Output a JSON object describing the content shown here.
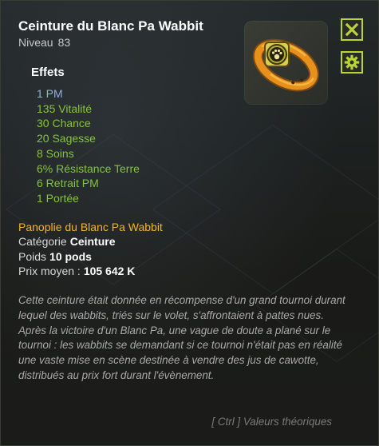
{
  "item": {
    "name": "Ceinture du Blanc Pa Wabbit",
    "level_label": "Niveau",
    "level_value": "83",
    "icon": "belt-item-icon"
  },
  "buttons": {
    "close_icon": "close-icon",
    "settings_icon": "gear-icon"
  },
  "effects": {
    "header": "Effets",
    "items": [
      {
        "text": "1 PM",
        "color": "#8fb0e0"
      },
      {
        "text": "135 Vitalité",
        "color": "#86c33a"
      },
      {
        "text": "30 Chance",
        "color": "#86c33a"
      },
      {
        "text": "20 Sagesse",
        "color": "#86c33a"
      },
      {
        "text": "8 Soins",
        "color": "#86c33a"
      },
      {
        "text": "6% Résistance Terre",
        "color": "#86c33a"
      },
      {
        "text": "6 Retrait PM",
        "color": "#86c33a"
      },
      {
        "text": "1 Portée",
        "color": "#86c33a"
      }
    ]
  },
  "details": {
    "set_name": "Panoplie du Blanc Pa Wabbit",
    "category_label": "Catégorie",
    "category_value": "Ceinture",
    "weight_label": "Poids",
    "weight_value": "10 pods",
    "price_label": "Prix moyen :",
    "price_value": "105 642 K"
  },
  "description": "Cette ceinture était donnée en récompense d'un grand tournoi durant lequel des wabbits, triés sur le volet, s'affrontaient à pattes nues. Après la victoire d'un Blanc Pa, une vague de doute a plané sur le tournoi : les wabbits se demandant si ce tournoi n'était pas en réalité une vaste mise en scène destinée à vendre des jus de cawotte, distribués au prix fort durant l'évènement.",
  "footer": "[ Ctrl ] Valeurs théoriques",
  "colors": {
    "accent": "#b9d435",
    "set_name": "#f2b527",
    "effect_pm": "#8fb0e0",
    "effect_green": "#86c33a"
  }
}
